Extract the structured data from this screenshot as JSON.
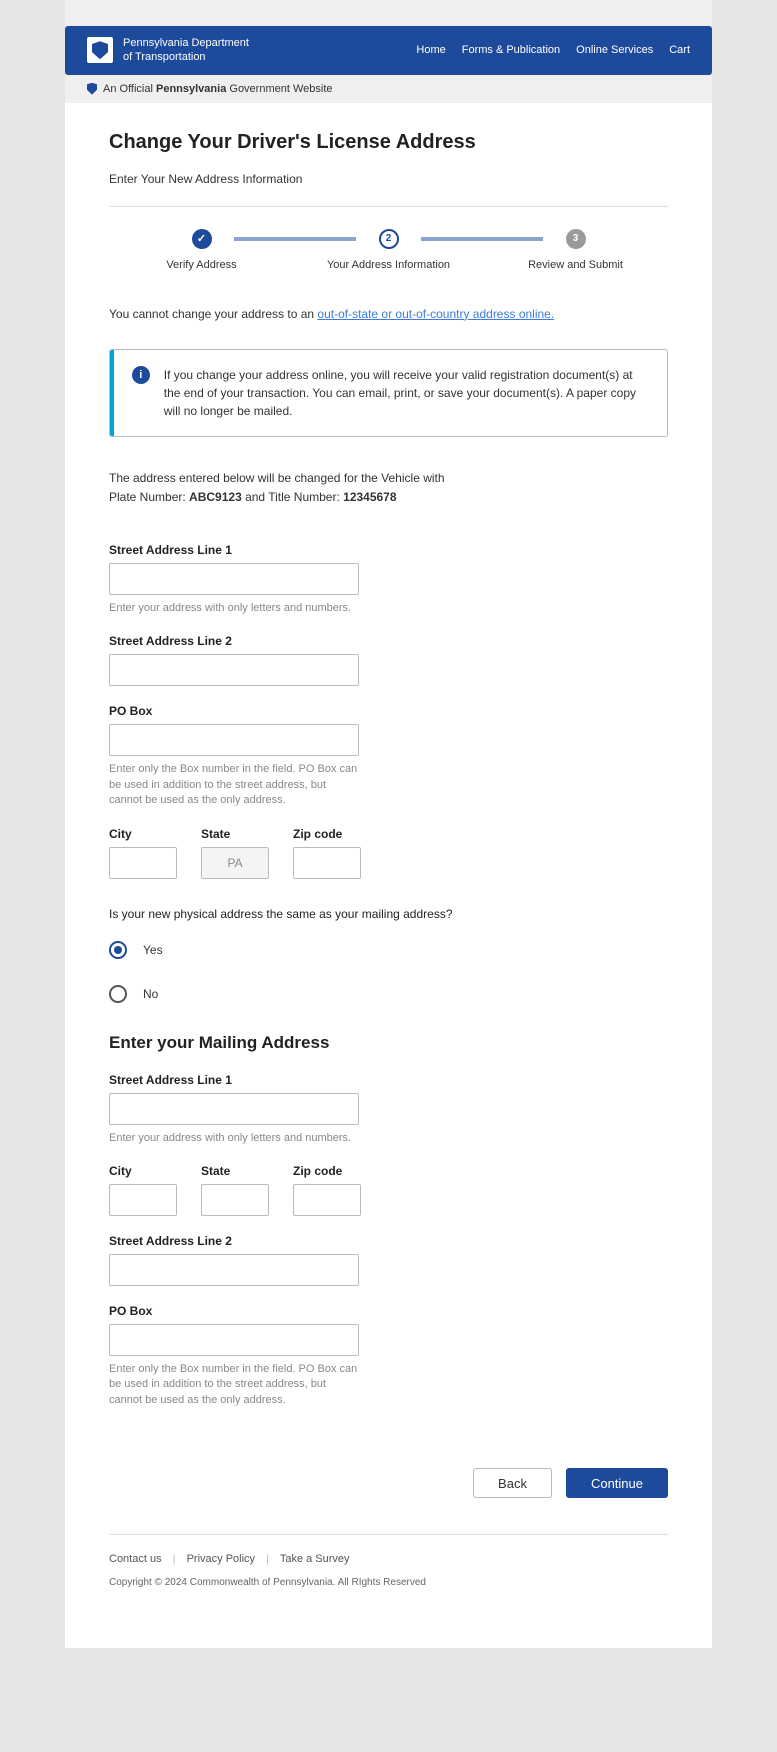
{
  "header": {
    "dept_line1": "Pennsylvania Department",
    "dept_line2": "of Transportation",
    "nav": [
      "Home",
      "Forms & Publication",
      "Online Services",
      "Cart"
    ]
  },
  "official_bar": {
    "prefix": "An Official ",
    "bold": "Pennsylvania",
    "suffix": " Government Website"
  },
  "page_title": "Change Your Driver's License Address",
  "page_subtitle": "Enter Your New Address Information",
  "steps": {
    "s1": {
      "num": "✓",
      "label": "Verify Address"
    },
    "s2": {
      "num": "2",
      "label": "Your Address Information"
    },
    "s3": {
      "num": "3",
      "label": "Review and Submit"
    }
  },
  "restriction": {
    "prefix": "You cannot change your address to an ",
    "link": "out-of-state or out-of-country address online."
  },
  "info_callout": "If you change your address online, you will receive your valid registration document(s) at the end of your transaction. You can email, print, or save your document(s). A paper copy will no longer be mailed.",
  "vehicle": {
    "line1": "The address entered below will be changed for the Vehicle with",
    "plate_prefix": "Plate Number: ",
    "plate": "ABC9123",
    "mid": " and Title Number: ",
    "title_num": "12345678"
  },
  "physical": {
    "street1_label": "Street Address Line 1",
    "street1_help": "Enter your address with only letters and numbers.",
    "street2_label": "Street Address Line 2",
    "pobox_label": "PO Box",
    "pobox_help": "Enter only the Box number in the field. PO Box can be used in addition to the street address, but cannot be used as the only address.",
    "city_label": "City",
    "state_label": "State",
    "state_value": "PA",
    "zip_label": "Zip code"
  },
  "same_question": "Is your new physical address the same as your mailing address?",
  "radio": {
    "yes": "Yes",
    "no": "No"
  },
  "mailing_heading": "Enter your Mailing Address",
  "mailing": {
    "street1_label": "Street Address Line 1",
    "street1_help": "Enter your address with only letters and numbers.",
    "city_label": "City",
    "state_label": "State",
    "zip_label": "Zip code",
    "street2_label": "Street Address Line 2",
    "pobox_label": "PO Box",
    "pobox_help": "Enter only the Box number in the field. PO Box can be used in addition to the street address, but cannot be used as the only address."
  },
  "buttons": {
    "back": "Back",
    "continue": "Continue"
  },
  "footer": {
    "links": [
      "Contact us",
      "Privacy Policy",
      "Take a Survey"
    ],
    "copyright": "Copyright © 2024 Commonwealth of Pennsylvania. All RIghts Reserved"
  }
}
